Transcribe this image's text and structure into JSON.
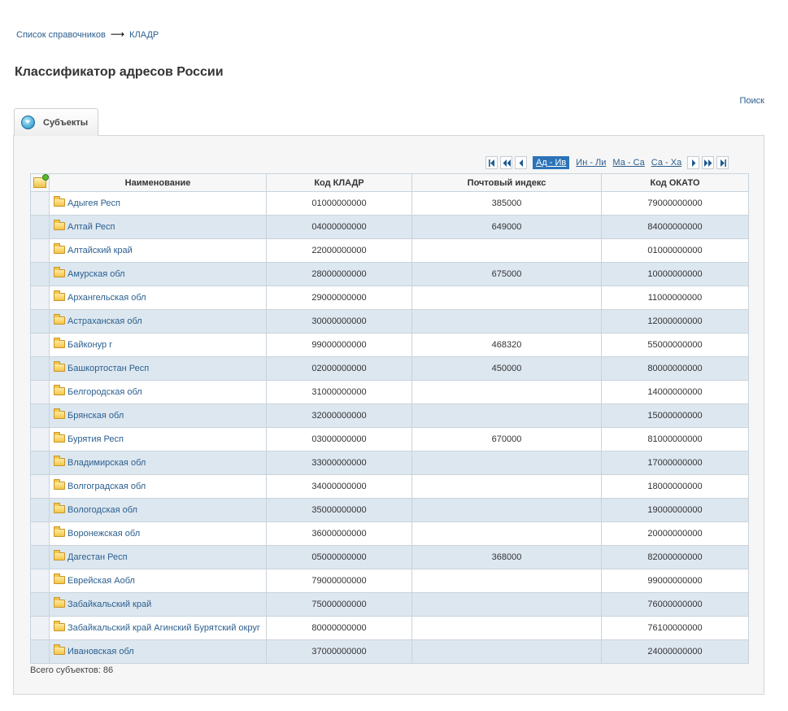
{
  "breadcrumb": {
    "parent": "Список справочников",
    "separator": "⟶",
    "current": "КЛАДР"
  },
  "page_title": "Классификатор адресов России",
  "search_link": "Поиск",
  "tab": {
    "label": "Субъекты"
  },
  "pager": {
    "ranges": [
      "Ад - Ив",
      "Ин - Ли",
      "Ма - Са",
      "Са - Ха"
    ],
    "active_range": "Ад - Ив"
  },
  "table": {
    "headers": {
      "name": "Наименование",
      "kladr": "Код КЛАДР",
      "postal": "Почтовый индекс",
      "okato": "Код ОКАТО"
    },
    "rows": [
      {
        "name": "Адыгея Респ",
        "kladr": "01000000000",
        "postal": "385000",
        "okato": "79000000000"
      },
      {
        "name": "Алтай Респ",
        "kladr": "04000000000",
        "postal": "649000",
        "okato": "84000000000"
      },
      {
        "name": "Алтайский край",
        "kladr": "22000000000",
        "postal": "",
        "okato": "01000000000"
      },
      {
        "name": "Амурская обл",
        "kladr": "28000000000",
        "postal": "675000",
        "okato": "10000000000"
      },
      {
        "name": "Архангельская обл",
        "kladr": "29000000000",
        "postal": "",
        "okato": "11000000000"
      },
      {
        "name": "Астраханская обл",
        "kladr": "30000000000",
        "postal": "",
        "okato": "12000000000"
      },
      {
        "name": "Байконур г",
        "kladr": "99000000000",
        "postal": "468320",
        "okato": "55000000000"
      },
      {
        "name": "Башкортостан Респ",
        "kladr": "02000000000",
        "postal": "450000",
        "okato": "80000000000"
      },
      {
        "name": "Белгородская обл",
        "kladr": "31000000000",
        "postal": "",
        "okato": "14000000000"
      },
      {
        "name": "Брянская обл",
        "kladr": "32000000000",
        "postal": "",
        "okato": "15000000000"
      },
      {
        "name": "Бурятия Респ",
        "kladr": "03000000000",
        "postal": "670000",
        "okato": "81000000000"
      },
      {
        "name": "Владимирская обл",
        "kladr": "33000000000",
        "postal": "",
        "okato": "17000000000"
      },
      {
        "name": "Волгоградская обл",
        "kladr": "34000000000",
        "postal": "",
        "okato": "18000000000"
      },
      {
        "name": "Вологодская обл",
        "kladr": "35000000000",
        "postal": "",
        "okato": "19000000000"
      },
      {
        "name": "Воронежская обл",
        "kladr": "36000000000",
        "postal": "",
        "okato": "20000000000"
      },
      {
        "name": "Дагестан Респ",
        "kladr": "05000000000",
        "postal": "368000",
        "okato": "82000000000"
      },
      {
        "name": "Еврейская Аобл",
        "kladr": "79000000000",
        "postal": "",
        "okato": "99000000000"
      },
      {
        "name": "Забайкальский край",
        "kladr": "75000000000",
        "postal": "",
        "okato": "76000000000"
      },
      {
        "name": "Забайкальский край Агинский Бурятский округ",
        "kladr": "80000000000",
        "postal": "",
        "okato": "76100000000"
      },
      {
        "name": "Ивановская обл",
        "kladr": "37000000000",
        "postal": "",
        "okato": "24000000000"
      }
    ]
  },
  "total": "Всего субъектов: 86",
  "icons": [
    "tab-toggle-icon",
    "add-folder-icon",
    "folder-icon",
    "first-page-icon",
    "prev-group-icon",
    "prev-page-icon",
    "next-page-icon",
    "next-group-icon",
    "last-page-icon"
  ]
}
